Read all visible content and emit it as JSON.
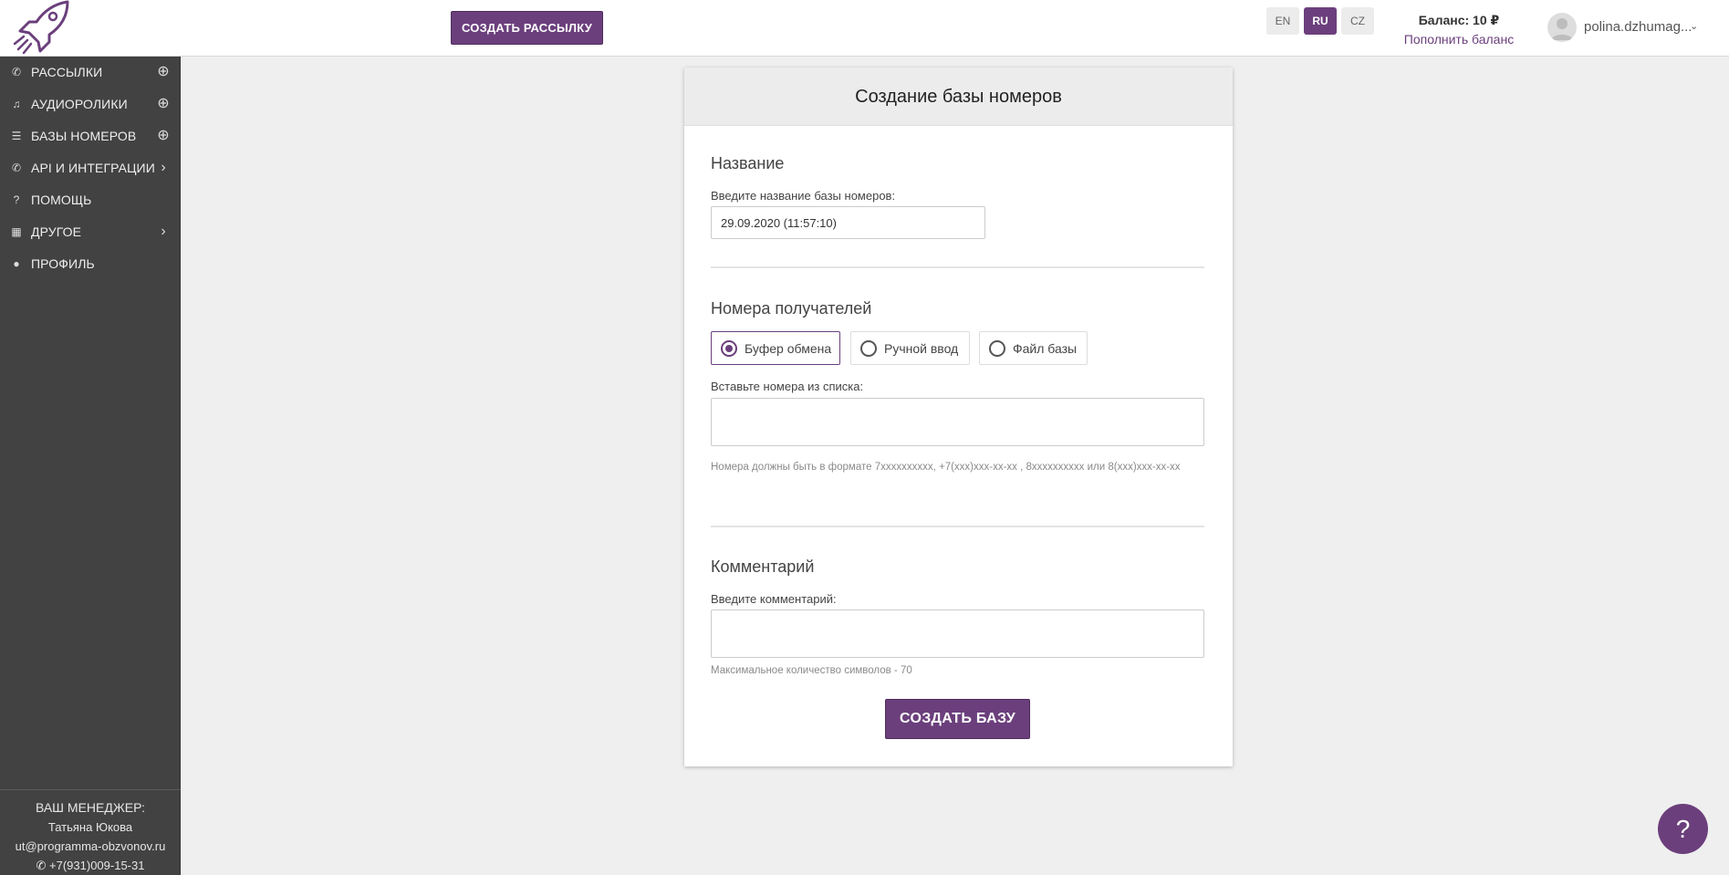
{
  "header": {
    "create_mailing_label": "СОЗДАТЬ РАССЫЛКУ",
    "languages": [
      "EN",
      "RU",
      "CZ"
    ],
    "active_language": "RU",
    "balance": "Баланс: 10 ₽",
    "topup_label": "Пополнить баланс",
    "username": "polina.dzhumag..."
  },
  "sidebar": {
    "items": [
      {
        "label": "РАССЫЛКИ",
        "icon": "phone-icon",
        "trail": "add-circle-icon"
      },
      {
        "label": "АУДИОРОЛИКИ",
        "icon": "audio-icon",
        "trail": "add-circle-icon"
      },
      {
        "label": "БАЗЫ НОМЕРОВ",
        "icon": "database-icon",
        "trail": "add-circle-icon"
      },
      {
        "label": "API И ИНТЕГРАЦИИ",
        "icon": "phone-forward-icon",
        "trail": "chevron-right-icon"
      },
      {
        "label": "ПОМОЩЬ",
        "icon": "question-icon",
        "trail": ""
      },
      {
        "label": "ДРУГОЕ",
        "icon": "apps-grid-icon",
        "trail": "chevron-right-icon"
      },
      {
        "label": "ПРОФИЛЬ",
        "icon": "person-icon",
        "trail": ""
      }
    ],
    "manager": {
      "title": "ВАШ МЕНЕДЖЕР:",
      "name": "Татьяна Юкова",
      "email": "ut@programma-obzvonov.ru",
      "phone": "+7(931)009-15-31"
    }
  },
  "form": {
    "title": "Создание базы номеров",
    "name_section": "Название",
    "name_label": "Введите название базы номеров:",
    "name_value": "29.09.2020 (11:57:10)",
    "recipients_section": "Номера получателей",
    "options": [
      "Буфер обмена",
      "Ручной ввод",
      "Файл базы"
    ],
    "selected_option": "Буфер обмена",
    "paste_label": "Вставьте номера из списка:",
    "format_hint": "Номера должны быть в формате 7xxxxxxxxxx, +7(xxx)xxx-xx-xx , 8xxxxxxxxxx или 8(xxx)xxx-xx-xx",
    "comment_section": "Комментарий",
    "comment_label": "Введите комментарий:",
    "comment_hint": "Максимальное количество символов - 70",
    "submit_label": "СОЗДАТЬ БАЗУ"
  },
  "help_fab": "?",
  "colors": {
    "accent": "#6b3f7c",
    "sidebar_bg": "#424242",
    "page_bg": "#efefef"
  }
}
